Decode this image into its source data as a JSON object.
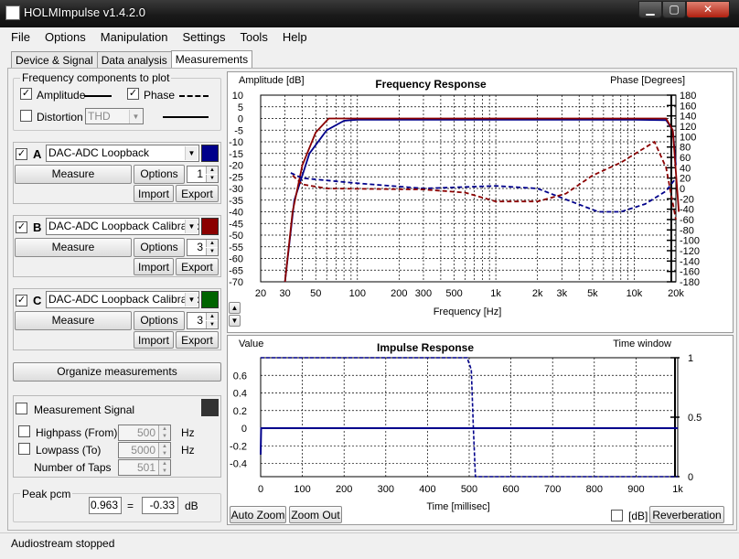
{
  "window": {
    "title": "HOLMImpulse  v1.4.2.0"
  },
  "menu": [
    "File",
    "Options",
    "Manipulation",
    "Settings",
    "Tools",
    "Help"
  ],
  "tabs": [
    "Device & Signal",
    "Data analysis",
    "Measurements"
  ],
  "freq_components": {
    "title": "Frequency components to plot",
    "amplitude": "Amplitude",
    "phase": "Phase",
    "distortion": "Distortion",
    "thd": "THD"
  },
  "measurements": [
    {
      "letter": "A",
      "name": "DAC-ADC Loopback",
      "color": "#00008b",
      "count": "1",
      "checked": true
    },
    {
      "letter": "B",
      "name": "DAC-ADC Loopback Calibrated",
      "color": "#8b0000",
      "count": "3",
      "checked": true
    },
    {
      "letter": "C",
      "name": "DAC-ADC Loopback Calibrated",
      "color": "#006400",
      "count": "3",
      "checked": true
    }
  ],
  "buttons": {
    "measure": "Measure",
    "options": "Options",
    "import": "Import",
    "export": "Export",
    "organize": "Organize measurements",
    "auto_zoom": "Auto Zoom",
    "zoom_out": "Zoom Out",
    "reverberation": "Reverberation"
  },
  "signal": {
    "label": "Measurement Signal",
    "highpass": "Highpass (From)",
    "highpass_value": "500",
    "lowpass": "Lowpass (To)",
    "lowpass_value": "5000",
    "taps": "Number of Taps",
    "taps_value": "501",
    "hz": "Hz"
  },
  "peak": {
    "title": "Peak pcm",
    "value": "0.963",
    "eq": "=",
    "db": "-0.33",
    "unit": "dB"
  },
  "status": "Audiostream stopped",
  "db_label": "[dB]",
  "colors": {
    "amplitude_a": "#00008b",
    "amplitude_b": "#8b0000"
  },
  "chart_data": [
    {
      "type": "line",
      "title": "Frequency Response",
      "ylabel": "Amplitude [dB]",
      "y2label": "Phase [Degrees]",
      "xlabel": "Frequency [Hz]",
      "xscale": "log",
      "xlim": [
        20,
        20000
      ],
      "ylim": [
        -70,
        10
      ],
      "y2lim": [
        -180,
        180
      ],
      "xticks": [
        "20",
        "30",
        "50",
        "100",
        "200",
        "300",
        "500",
        "1k",
        "2k",
        "3k",
        "5k",
        "10k",
        "20k"
      ],
      "yticks": [
        "10",
        "5",
        "0",
        "-5",
        "-10",
        "-15",
        "-20",
        "-25",
        "-30",
        "-35",
        "-40",
        "-45",
        "-50",
        "-55",
        "-60",
        "-65",
        "-70"
      ],
      "y2ticks": [
        "180",
        "160",
        "140",
        "120",
        "100",
        "80",
        "60",
        "40",
        "20",
        "0",
        "-20",
        "-40",
        "-60",
        "-80",
        "-100",
        "-120",
        "-140",
        "-160",
        "-180"
      ],
      "series": [
        {
          "kind": "amplitude",
          "color": "#00008b",
          "points": [
            [
              30,
              -70
            ],
            [
              35,
              -35
            ],
            [
              45,
              -15
            ],
            [
              60,
              -5
            ],
            [
              80,
              -1
            ],
            [
              100,
              -0.5
            ],
            [
              1000,
              -0.5
            ],
            [
              10000,
              -0.5
            ],
            [
              17000,
              -0.7
            ],
            [
              19000,
              -5
            ],
            [
              20000,
              -20
            ]
          ]
        },
        {
          "kind": "amplitude",
          "color": "#8b0000",
          "points": [
            [
              30,
              -70
            ],
            [
              34,
              -40
            ],
            [
              40,
              -20
            ],
            [
              50,
              -6
            ],
            [
              62,
              0
            ],
            [
              80,
              0
            ],
            [
              1000,
              0
            ],
            [
              10000,
              0
            ],
            [
              17000,
              0
            ],
            [
              19000,
              -5
            ],
            [
              21000,
              -40
            ]
          ]
        },
        {
          "kind": "phase",
          "color": "#00008b",
          "points": [
            [
              33,
              30
            ],
            [
              40,
              20
            ],
            [
              100,
              10
            ],
            [
              300,
              0
            ],
            [
              1000,
              5
            ],
            [
              2000,
              0
            ],
            [
              3500,
              -25
            ],
            [
              5500,
              -45
            ],
            [
              8000,
              -45
            ],
            [
              12000,
              -30
            ],
            [
              17000,
              -5
            ],
            [
              20000,
              20
            ]
          ]
        },
        {
          "kind": "phase",
          "color": "#8b0000",
          "points": [
            [
              34,
              25
            ],
            [
              40,
              8
            ],
            [
              60,
              0
            ],
            [
              300,
              -2
            ],
            [
              600,
              -8
            ],
            [
              1000,
              -25
            ],
            [
              2000,
              -25
            ],
            [
              3200,
              -10
            ],
            [
              5000,
              25
            ],
            [
              8000,
              50
            ],
            [
              14000,
              90
            ],
            [
              17000,
              40
            ],
            [
              20000,
              -60
            ]
          ]
        }
      ]
    },
    {
      "type": "line",
      "title": "Impulse Response",
      "ylabel": "Value",
      "y2label": "Time window",
      "xlabel": "Time [millisec]",
      "xlim": [
        0,
        1000
      ],
      "ylim": [
        -0.55,
        0.8
      ],
      "y2lim": [
        0,
        1
      ],
      "xticks": [
        "0",
        "100",
        "200",
        "300",
        "400",
        "500",
        "600",
        "700",
        "800",
        "900",
        "1k"
      ],
      "yticks": [
        "0.6",
        "0.4",
        "0.2",
        "0",
        "-0.2",
        "-0.4"
      ],
      "y2ticks": [
        "1",
        "0.5",
        "0"
      ],
      "series": [
        {
          "kind": "impulse",
          "color": "#00008b",
          "points": [
            [
              0,
              -0.3
            ],
            [
              1,
              0
            ],
            [
              1000,
              0
            ]
          ]
        },
        {
          "kind": "window",
          "color": "#00008b",
          "points": [
            [
              0,
              1
            ],
            [
              495,
              1
            ],
            [
              505,
              0.9
            ],
            [
              510,
              0.4
            ],
            [
              515,
              0
            ],
            [
              1000,
              0
            ]
          ]
        }
      ]
    }
  ]
}
